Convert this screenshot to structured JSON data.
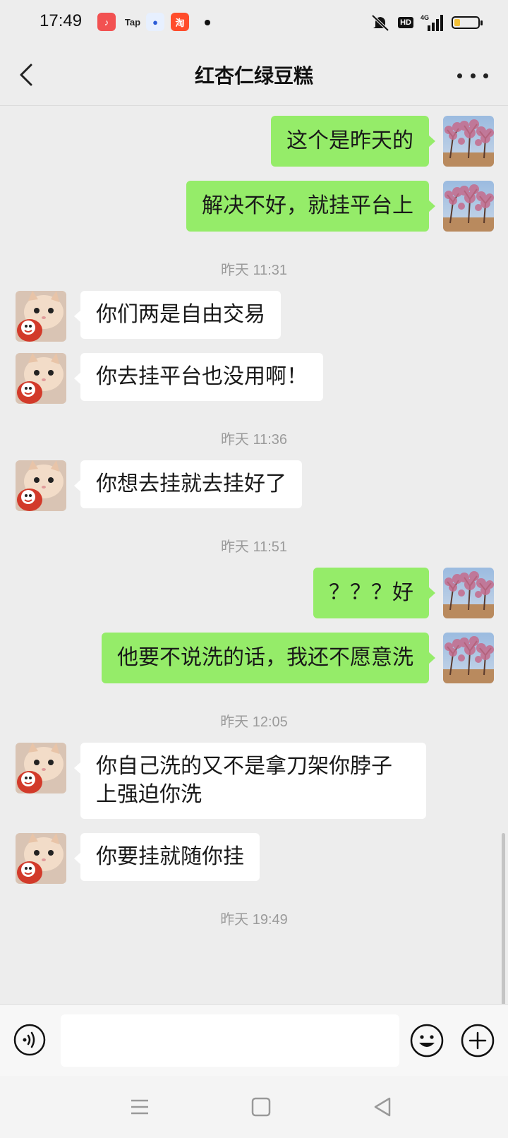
{
  "status_bar": {
    "time": "17:49",
    "apps": [
      "music-app-icon",
      "tap-app-icon",
      "baidu-app-icon",
      "taobao-app-icon"
    ],
    "tap_label": "Tap",
    "taobao_label": "淘",
    "network": "4G",
    "hd_label": "HD",
    "battery_level": 0.25
  },
  "header": {
    "title": "红杏仁绿豆糕"
  },
  "messages": [
    {
      "type": "msg",
      "sender": "me",
      "text": "这个是昨天的"
    },
    {
      "type": "msg",
      "sender": "me",
      "text": "解决不好，就挂平台上"
    },
    {
      "type": "time",
      "text": "昨天 11:31"
    },
    {
      "type": "msg",
      "sender": "other",
      "text": "你们两是自由交易"
    },
    {
      "type": "msg",
      "sender": "other",
      "text": "你去挂平台也没用啊！"
    },
    {
      "type": "time",
      "text": "昨天 11:36"
    },
    {
      "type": "msg",
      "sender": "other",
      "text": "你想去挂就去挂好了"
    },
    {
      "type": "time",
      "text": "昨天 11:51"
    },
    {
      "type": "msg",
      "sender": "me",
      "text": "？？？好"
    },
    {
      "type": "msg",
      "sender": "me",
      "text": "他要不说洗的话，我还不愿意洗"
    },
    {
      "type": "time",
      "text": "昨天 12:05"
    },
    {
      "type": "msg",
      "sender": "other",
      "text": "你自己洗的又不是拿刀架你脖子上强迫你洗"
    },
    {
      "type": "msg",
      "sender": "other",
      "text": "你要挂就随你挂"
    },
    {
      "type": "time",
      "text": "昨天 19:49"
    }
  ],
  "input": {
    "value": "",
    "placeholder": ""
  },
  "colors": {
    "my_bubble": "#95ec69",
    "other_bubble": "#ffffff",
    "background": "#ededed"
  }
}
